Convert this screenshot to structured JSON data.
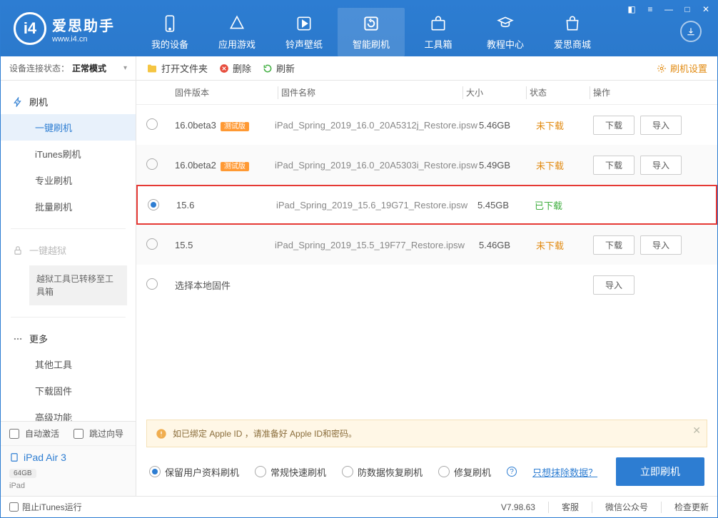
{
  "app": {
    "name": "爱思助手",
    "site": "www.i4.cn"
  },
  "topnav": [
    {
      "label": "我的设备"
    },
    {
      "label": "应用游戏"
    },
    {
      "label": "铃声壁纸"
    },
    {
      "label": "智能刷机"
    },
    {
      "label": "工具箱"
    },
    {
      "label": "教程中心"
    },
    {
      "label": "爱思商城"
    }
  ],
  "connection": {
    "label": "设备连接状态：",
    "mode": "正常模式"
  },
  "side": {
    "flash_group": "刷机",
    "items": [
      "一键刷机",
      "iTunes刷机",
      "专业刷机",
      "批量刷机"
    ],
    "jailbreak": "一键越狱",
    "jailbreak_note": "越狱工具已转移至工具箱",
    "more_group": "更多",
    "more_items": [
      "其他工具",
      "下载固件",
      "高级功能"
    ],
    "auto_activate": "自动激活",
    "skip_guide": "跳过向导",
    "device_name": "iPad Air 3",
    "device_storage": "64GB",
    "device_type": "iPad"
  },
  "toolbar": {
    "open": "打开文件夹",
    "delete": "删除",
    "refresh": "刷新",
    "settings": "刷机设置"
  },
  "cols": {
    "ver": "固件版本",
    "name": "固件名称",
    "size": "大小",
    "status": "状态",
    "ops": "操作"
  },
  "status_labels": {
    "not": "未下载",
    "done": "已下载"
  },
  "btn": {
    "download": "下载",
    "import": "导入"
  },
  "local_select": "选择本地固件",
  "firmware": [
    {
      "ver": "16.0beta3",
      "beta": true,
      "name": "iPad_Spring_2019_16.0_20A5312j_Restore.ipsw",
      "size": "5.46GB",
      "downloaded": false
    },
    {
      "ver": "16.0beta2",
      "beta": true,
      "name": "iPad_Spring_2019_16.0_20A5303i_Restore.ipsw",
      "size": "5.49GB",
      "downloaded": false
    },
    {
      "ver": "15.6",
      "beta": false,
      "name": "iPad_Spring_2019_15.6_19G71_Restore.ipsw",
      "size": "5.45GB",
      "downloaded": true
    },
    {
      "ver": "15.5",
      "beta": false,
      "name": "iPad_Spring_2019_15.5_19F77_Restore.ipsw",
      "size": "5.46GB",
      "downloaded": false
    }
  ],
  "notice": "如已绑定 Apple ID ，请准备好 Apple ID和密码。",
  "flash_opts": [
    "保留用户资料刷机",
    "常规快速刷机",
    "防数据恢复刷机",
    "修复刷机"
  ],
  "erase_link": "只想抹除数据？",
  "flash_btn": "立即刷机",
  "status": {
    "block_itunes": "阻止iTunes运行",
    "version": "V7.98.63",
    "cs": "客服",
    "wx": "微信公众号",
    "upd": "检查更新"
  },
  "beta_tag": "测试版"
}
